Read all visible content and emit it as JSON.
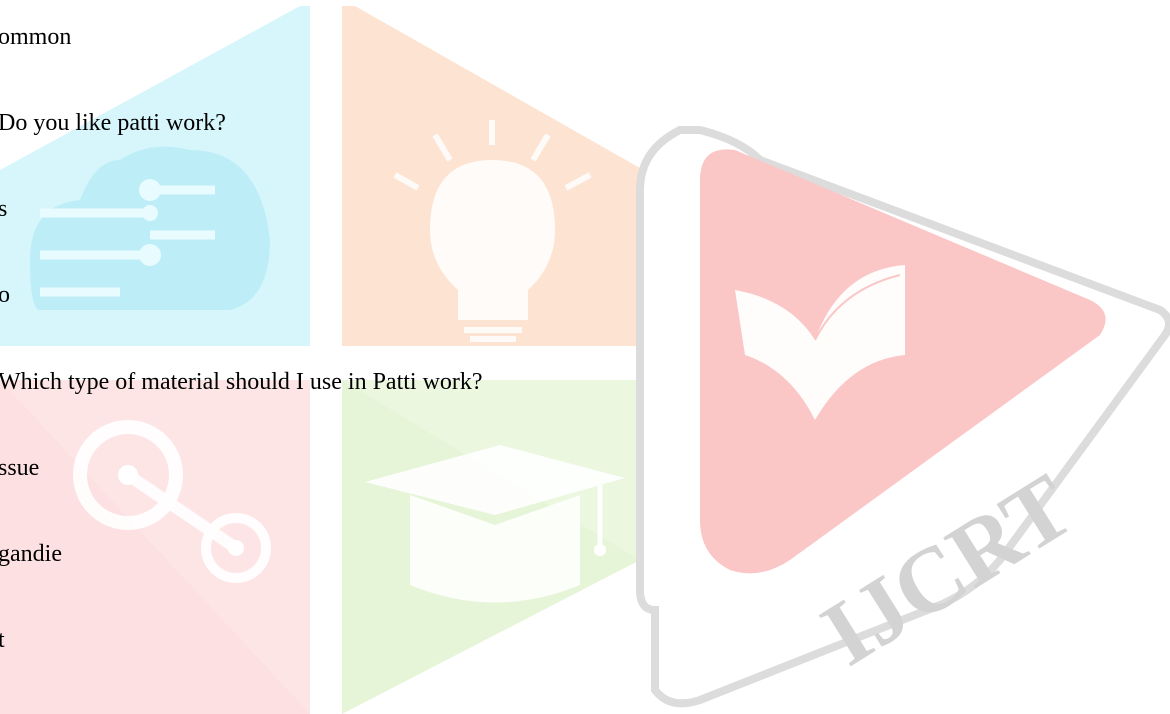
{
  "document": {
    "lines": [
      "ommon",
      "Do you like patti work?",
      "s",
      "o",
      "Which type of material should I use in Patti work?",
      "ssue",
      "gandie",
      "t"
    ]
  },
  "watermark": {
    "text": "IJCRT",
    "colors": {
      "cyan": "#d6f6fb",
      "orange": "#fde4d2",
      "pink": "#fde0e2",
      "green": "#e6f5d8",
      "red": "#fbc6c6",
      "grey": "#d8d8d8"
    }
  }
}
